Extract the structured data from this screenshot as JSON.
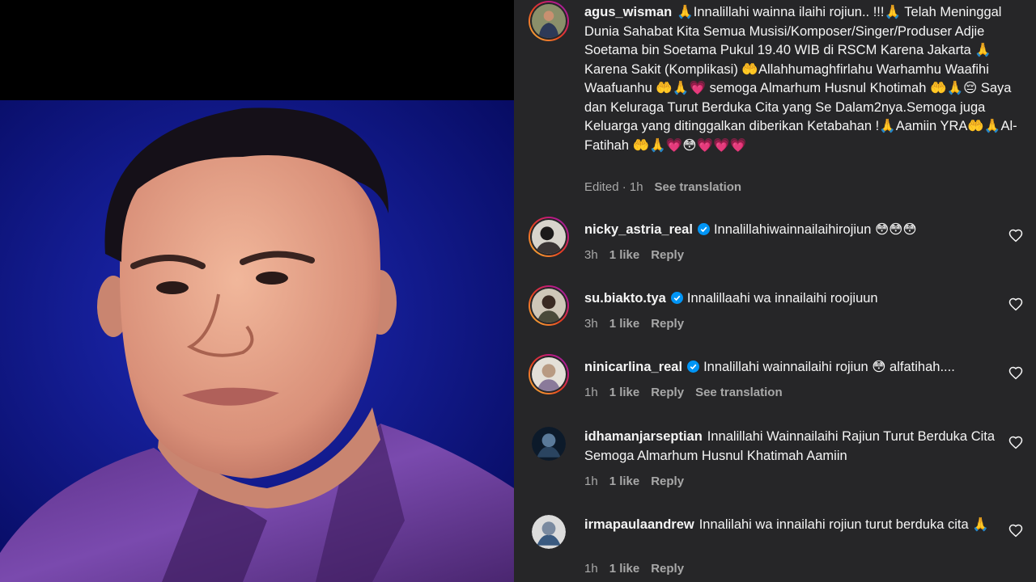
{
  "caption": {
    "username": "agus_wisman",
    "text": "🙏Innalillahi wainna ilaihi rojiun.. !!!🙏 Telah Meninggal Dunia Sahabat Kita Semua Musisi/Komposer/Singer/Produser Adjie Soetama bin Soetama Pukul 19.40 WIB di RSCM Karena Jakarta 🙏 Karena Sakit (Komplikasi) 🤲Allahhumaghfirlahu Warhamhu Waafihi Waafuanhu 🤲🙏💗 semoga Almarhum Husnul Khotimah 🤲🙏😔 Saya dan Keluraga Turut Berduka Cita yang Se Dalam2nya.Semoga juga Keluarga yang ditinggalkan diberikan Ketabahan !🙏Aamiin YRA🤲🙏Al-Fatihah 🤲🙏💗😳💗💗💗",
    "edited": "Edited · 1h",
    "see_translation": "See translation"
  },
  "comments": [
    {
      "username": "nicky_astria_real",
      "verified": true,
      "text": "Innalillahiwainnailaihirojiun 😳😳😳",
      "time": "3h",
      "likes": "1 like",
      "reply": "Reply"
    },
    {
      "username": "su.biakto.tya",
      "verified": true,
      "text": "Innalillaahi wa innailaihi roojiuun",
      "time": "3h",
      "likes": "1 like",
      "reply": "Reply"
    },
    {
      "username": "ninicarlina_real",
      "verified": true,
      "text": "Innalillahi wainnailaihi rojiun 😳 alfatihah....",
      "time": "1h",
      "likes": "1 like",
      "reply": "Reply",
      "see_translation": "See translation"
    },
    {
      "username": "idhamanjarseptian",
      "verified": false,
      "text": "Innalillahi Wainnailaihi Rajiun Turut Berduka Cita Semoga Almarhum Husnul Khatimah Aamiin",
      "time": "1h",
      "likes": "1 like",
      "reply": "Reply"
    },
    {
      "username": "irmapaulaandrew",
      "verified": false,
      "text": "Innalilahi wa innailahi rojiun turut berduka cita 🙏",
      "time": "1h",
      "likes": "1 like",
      "reply": "Reply"
    }
  ],
  "icons": {
    "verified": "verified-badge-icon",
    "like": "heart-outline-icon"
  },
  "colors": {
    "panel_background": "#262628",
    "text_primary": "#f5f5f5",
    "text_secondary": "#a8a8a8",
    "verified_blue": "#0095f6",
    "photo_background": "#0b0f86",
    "shirt_purple": "#6a3f9a"
  }
}
